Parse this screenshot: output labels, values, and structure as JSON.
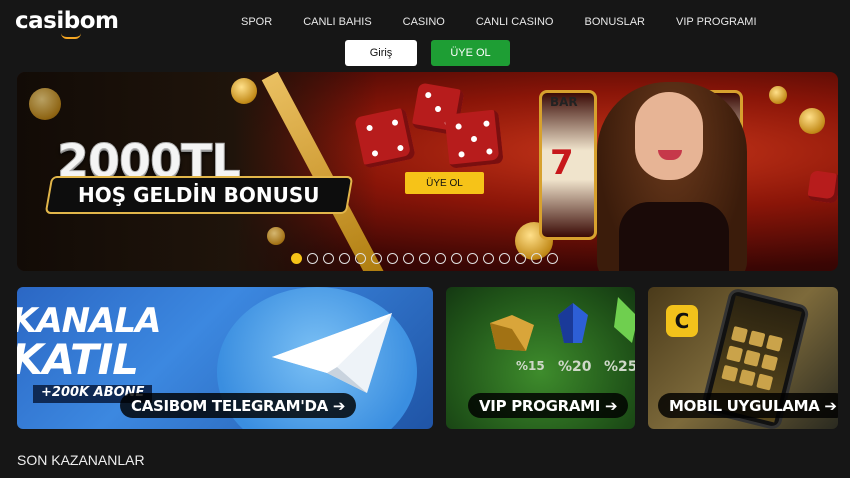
{
  "brand": {
    "logo_text": "casibom",
    "accent": "#f5a623"
  },
  "nav": {
    "items": [
      "SPOR",
      "CANLI BAHIS",
      "CASINO",
      "CANLI CASINO",
      "BONUSLAR",
      "VIP PROGRAMI"
    ]
  },
  "auth": {
    "login_label": "Giriş",
    "register_label": "ÜYE OL",
    "register_color": "#1e9e34"
  },
  "hero": {
    "amount": "2000TL",
    "headline": "HOŞ GELDİN BONUSU",
    "cta_label": "ÜYE OL",
    "slot_symbol": "7",
    "slot_bar": "BAR",
    "slide_count": 17,
    "active_slide": 0
  },
  "promos": {
    "telegram": {
      "line1": "KANALA",
      "line2": "KATIL",
      "subscribers": "+200K ABONE",
      "label": "CASIBOM TELEGRAM'DA ➔"
    },
    "vip": {
      "label": "VIP PROGRAMI ➔",
      "percents": [
        "%15",
        "%20",
        "%25"
      ]
    },
    "mobile": {
      "label": "MOBIL UYGULAMA ➔",
      "app_letter": "C",
      "os_icons": ""
    }
  },
  "sections": {
    "recent_winners_title": "SON KAZANANLAR"
  }
}
